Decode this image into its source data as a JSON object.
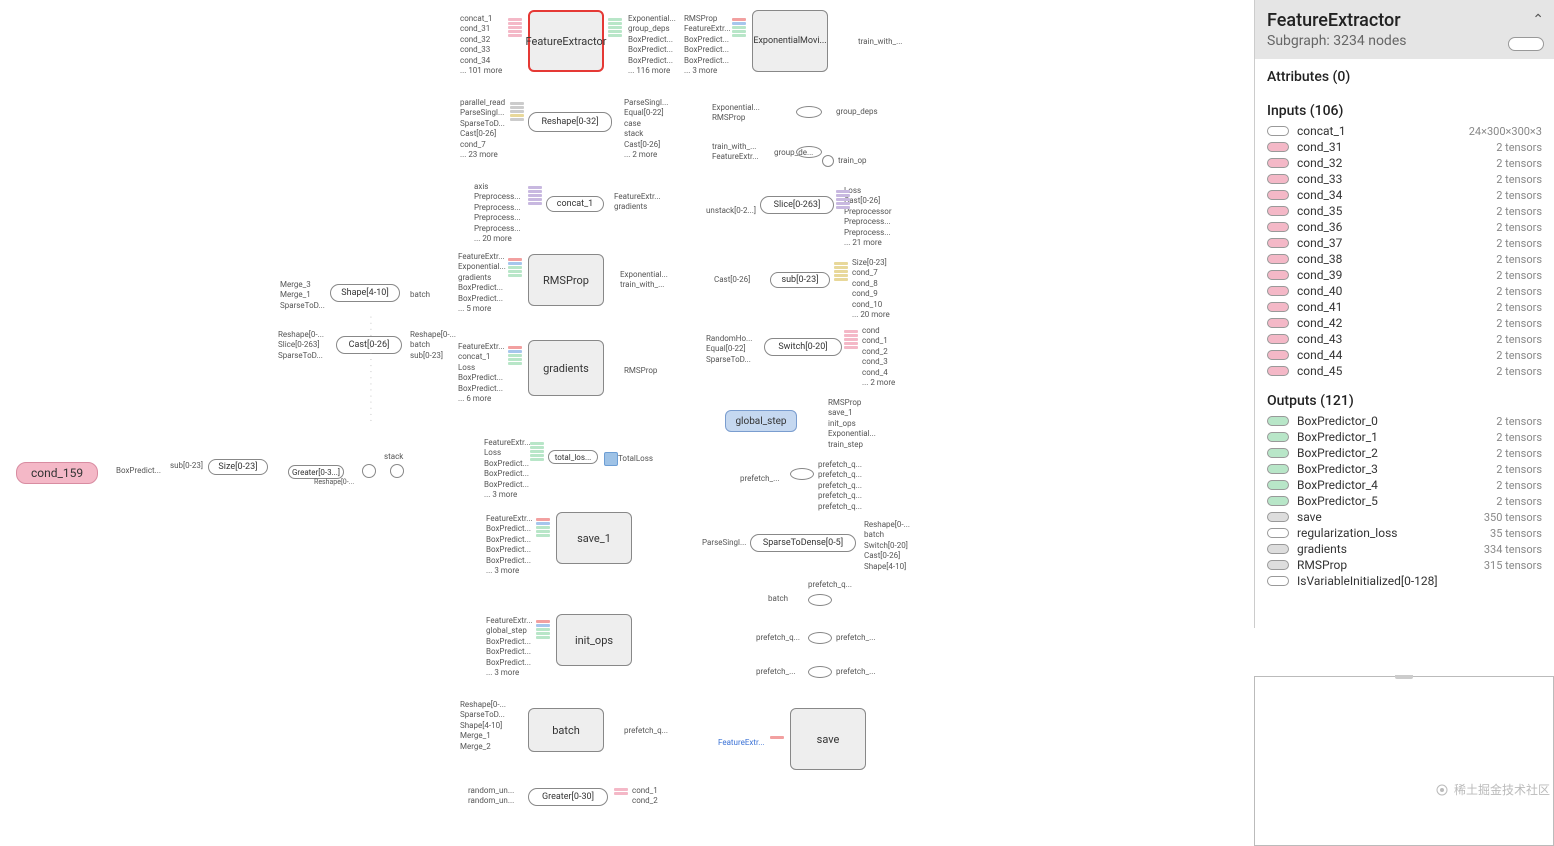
{
  "sidebar": {
    "title": "FeatureExtractor",
    "subgraph": "Subgraph: 3234 nodes",
    "attributes_header": "Attributes (0)",
    "inputs_header": "Inputs (106)",
    "outputs_header": "Outputs (121)",
    "inputs": [
      {
        "swatch": "sw-ell",
        "name": "concat_1",
        "val": "24×300×300×3"
      },
      {
        "swatch": "sw-pink",
        "name": "cond_31",
        "val": "2 tensors"
      },
      {
        "swatch": "sw-pink",
        "name": "cond_32",
        "val": "2 tensors"
      },
      {
        "swatch": "sw-pink",
        "name": "cond_33",
        "val": "2 tensors"
      },
      {
        "swatch": "sw-pink",
        "name": "cond_34",
        "val": "2 tensors"
      },
      {
        "swatch": "sw-pink",
        "name": "cond_35",
        "val": "2 tensors"
      },
      {
        "swatch": "sw-pink",
        "name": "cond_36",
        "val": "2 tensors"
      },
      {
        "swatch": "sw-pink",
        "name": "cond_37",
        "val": "2 tensors"
      },
      {
        "swatch": "sw-pink",
        "name": "cond_38",
        "val": "2 tensors"
      },
      {
        "swatch": "sw-pink",
        "name": "cond_39",
        "val": "2 tensors"
      },
      {
        "swatch": "sw-pink",
        "name": "cond_40",
        "val": "2 tensors"
      },
      {
        "swatch": "sw-pink",
        "name": "cond_41",
        "val": "2 tensors"
      },
      {
        "swatch": "sw-pink",
        "name": "cond_42",
        "val": "2 tensors"
      },
      {
        "swatch": "sw-pink",
        "name": "cond_43",
        "val": "2 tensors"
      },
      {
        "swatch": "sw-pink",
        "name": "cond_44",
        "val": "2 tensors"
      },
      {
        "swatch": "sw-pink",
        "name": "cond_45",
        "val": "2 tensors"
      }
    ],
    "outputs": [
      {
        "swatch": "sw-green",
        "name": "BoxPredictor_0",
        "val": "2 tensors"
      },
      {
        "swatch": "sw-green",
        "name": "BoxPredictor_1",
        "val": "2 tensors"
      },
      {
        "swatch": "sw-green",
        "name": "BoxPredictor_2",
        "val": "2 tensors"
      },
      {
        "swatch": "sw-green",
        "name": "BoxPredictor_3",
        "val": "2 tensors"
      },
      {
        "swatch": "sw-green",
        "name": "BoxPredictor_4",
        "val": "2 tensors"
      },
      {
        "swatch": "sw-green",
        "name": "BoxPredictor_5",
        "val": "2 tensors"
      },
      {
        "swatch": "sw-grey",
        "name": "save",
        "val": "350 tensors"
      },
      {
        "swatch": "sw-ell",
        "name": "regularization_loss",
        "val": "35 tensors"
      },
      {
        "swatch": "sw-grey",
        "name": "gradients",
        "val": "334 tensors"
      },
      {
        "swatch": "sw-grey",
        "name": "RMSProp",
        "val": "315 tensors"
      },
      {
        "swatch": "sw-ell",
        "name": "IsVariableInitialized[0-128]",
        "val": ""
      }
    ]
  },
  "watermark": "稀土掘金技术社区",
  "graph": {
    "cond_node": "cond_159",
    "nodes": {
      "feature_extractor": "FeatureExtractor",
      "exponential_moving": "ExponentialMovi...",
      "reshape": "Reshape[0-32]",
      "slice": "Slice[0-263]",
      "shape": "Shape[4-10]",
      "cast": "Cast[0-26]",
      "rmsprop": "RMSProp",
      "sub": "sub[0-23]",
      "gradients": "gradients",
      "switch": "Switch[0-20]",
      "global_step": "global_step",
      "size": "Size[0-23]",
      "save1": "save_1",
      "sparse": "SparseToDense[0-5]",
      "init_ops": "init_ops",
      "batch": "batch",
      "greater": "Greater[0-30]",
      "save": "save",
      "greater0": "Greater[0-3...]",
      "stack": "stack",
      "concat1": "concat_1",
      "total_los": "total_los...",
      "total_loss": "TotalLoss"
    },
    "labels": {
      "fe_in": [
        "concat_1",
        "cond_31",
        "cond_32",
        "cond_33",
        "cond_34",
        "... 101 more"
      ],
      "fe_out": [
        "Exponential...",
        "group_deps",
        "BoxPredict...",
        "BoxPredict...",
        "BoxPredict...",
        "... 116 more"
      ],
      "em_in": [
        "RMSProp",
        "FeatureExtr...",
        "BoxPredict...",
        "BoxPredict...",
        "BoxPredict...",
        "... 3 more"
      ],
      "em_out": [
        "train_with_..."
      ],
      "reshape_in": [
        "parallel_read",
        "ParseSingl...",
        "SparseToD...",
        "Cast[0-26]",
        "cond_7",
        "... 23 more"
      ],
      "reshape_out": [
        "ParseSingl...",
        "Equal[0-22]",
        "case",
        "stack",
        "Cast[0-26]",
        "... 2 more"
      ],
      "slice_in": [
        "unstack[0-2...]"
      ],
      "slice_out": [
        "Loss",
        "Cast[0-26]",
        "Preprocessor",
        "Preprocess...",
        "Preprocess...",
        "... 21 more"
      ],
      "rmsprop_in": [
        "FeatureExtr...",
        "Exponential...",
        "gradients",
        "BoxPredict...",
        "BoxPredict...",
        "... 5 more"
      ],
      "rmsprop_out": [
        "Exponential...",
        "train_with_..."
      ],
      "sub_in": [
        "Cast[0-26]"
      ],
      "sub_out": [
        "Size[0-23]",
        "cond_7",
        "cond_8",
        "cond_9",
        "cond_10",
        "... 20 more"
      ],
      "grad_in": [
        "FeatureExtr...",
        "concat_1",
        "Loss",
        "BoxPredict...",
        "BoxPredict...",
        "... 6 more"
      ],
      "grad_out": [
        "RMSProp"
      ],
      "switch_in": [
        "RandomHo...",
        "Equal[0-22]",
        "SparseToD..."
      ],
      "switch_out": [
        "cond",
        "cond_1",
        "cond_2",
        "cond_3",
        "cond_4",
        "... 2 more"
      ],
      "gs_out": [
        "RMSProp",
        "save_1",
        "init_ops",
        "Exponential...",
        "train_step"
      ],
      "shape_in": [
        "Merge_3",
        "Merge_1",
        "SparseToD..."
      ],
      "shape_out": [
        "batch"
      ],
      "cast_in": [
        "Reshape[0-...",
        "Slice[0-263]",
        "SparseToD..."
      ],
      "cast_out": [
        "Reshape[0-...",
        "batch",
        "sub[0-23]"
      ],
      "size_in": [
        "sub[0-23]"
      ],
      "cond_out": [
        "BoxPredict..."
      ],
      "save1_in": [
        "FeatureExtr...",
        "BoxPredict...",
        "BoxPredict...",
        "BoxPredict...",
        "BoxPredict...",
        "... 3 more"
      ],
      "sparse_in": [
        "ParseSingl..."
      ],
      "sparse_out": [
        "Reshape[0-...",
        "batch",
        "Switch[0-20]",
        "Cast[0-26]",
        "Shape[4-10]"
      ],
      "init_in": [
        "FeatureExtr...",
        "global_step",
        "BoxPredict...",
        "BoxPredict...",
        "BoxPredict...",
        "... 3 more"
      ],
      "batch_in": [
        "Reshape[0-...",
        "SparseToD...",
        "Shape[4-10]",
        "Merge_1",
        "Merge_2"
      ],
      "batch_out": [
        "prefetch_q..."
      ],
      "greater_in": [
        "random_un...",
        "random_un..."
      ],
      "greater_out": [
        "cond_1",
        "cond_2"
      ],
      "save_in": [
        "FeatureExtr..."
      ],
      "tot_in": [
        "FeatureExtr...",
        "Loss",
        "BoxPredict...",
        "BoxPredict...",
        "BoxPredict...",
        "... 3 more"
      ],
      "concat_in": [
        "axis",
        "Preprocess...",
        "Preprocess...",
        "Preprocess...",
        "Preprocess...",
        "... 20 more"
      ],
      "concat_out": [
        "FeatureExtr...",
        "gradients"
      ],
      "ema_top": [
        "Exponential...",
        "RMSProp"
      ],
      "ema_top_out": [
        "group_deps"
      ],
      "train_with": [
        "train_with_...",
        "FeatureExtr..."
      ],
      "group_de": [
        "group_de..."
      ],
      "train_op": [
        "train_op"
      ],
      "prefetch_a": [
        "prefetch_q...",
        "prefetch_q...",
        "prefetch_q...",
        "prefetch_q...",
        "prefetch_q..."
      ],
      "prefetch_b": [
        "batch",
        "prefetch_q..."
      ],
      "prefetch_c": [
        "prefetch_q..."
      ]
    }
  }
}
